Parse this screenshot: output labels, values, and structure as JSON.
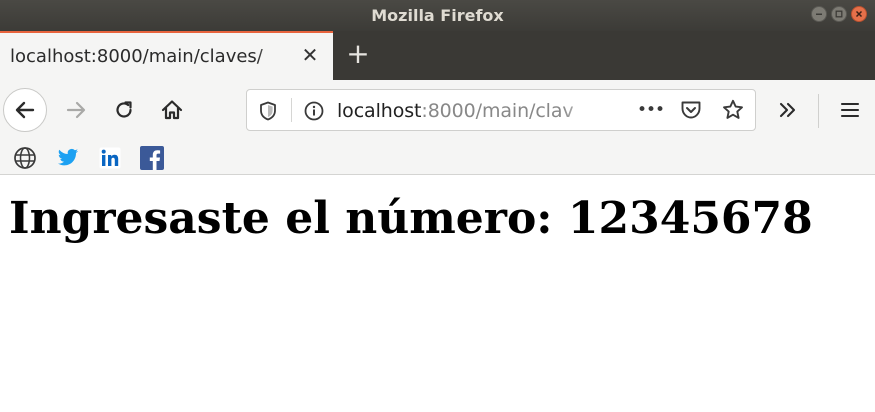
{
  "window": {
    "title": "Mozilla Firefox",
    "controls": [
      "minimize",
      "maximize",
      "close"
    ]
  },
  "tabs": [
    {
      "title": "localhost:8000/main/claves/",
      "active": true
    }
  ],
  "new_tab_glyph": "+",
  "tab_close_glyph": "✕",
  "urlbar": {
    "host": "localhost",
    "path": ":8000/main/clav",
    "page_actions_glyph": "•••"
  },
  "bookmarks": [
    {
      "icon": "globe-icon"
    },
    {
      "icon": "twitter-icon",
      "color": "#1da1f2"
    },
    {
      "icon": "linkedin-icon",
      "color": "#0a66c2"
    },
    {
      "icon": "facebook-icon",
      "color": "#3b5998"
    }
  ],
  "page": {
    "heading": "Ingresaste el número: 12345678"
  },
  "colors": {
    "titlebar": "#3c3b37",
    "active_tab_accent": "#e8643d",
    "toolbar": "#f5f5f4"
  }
}
